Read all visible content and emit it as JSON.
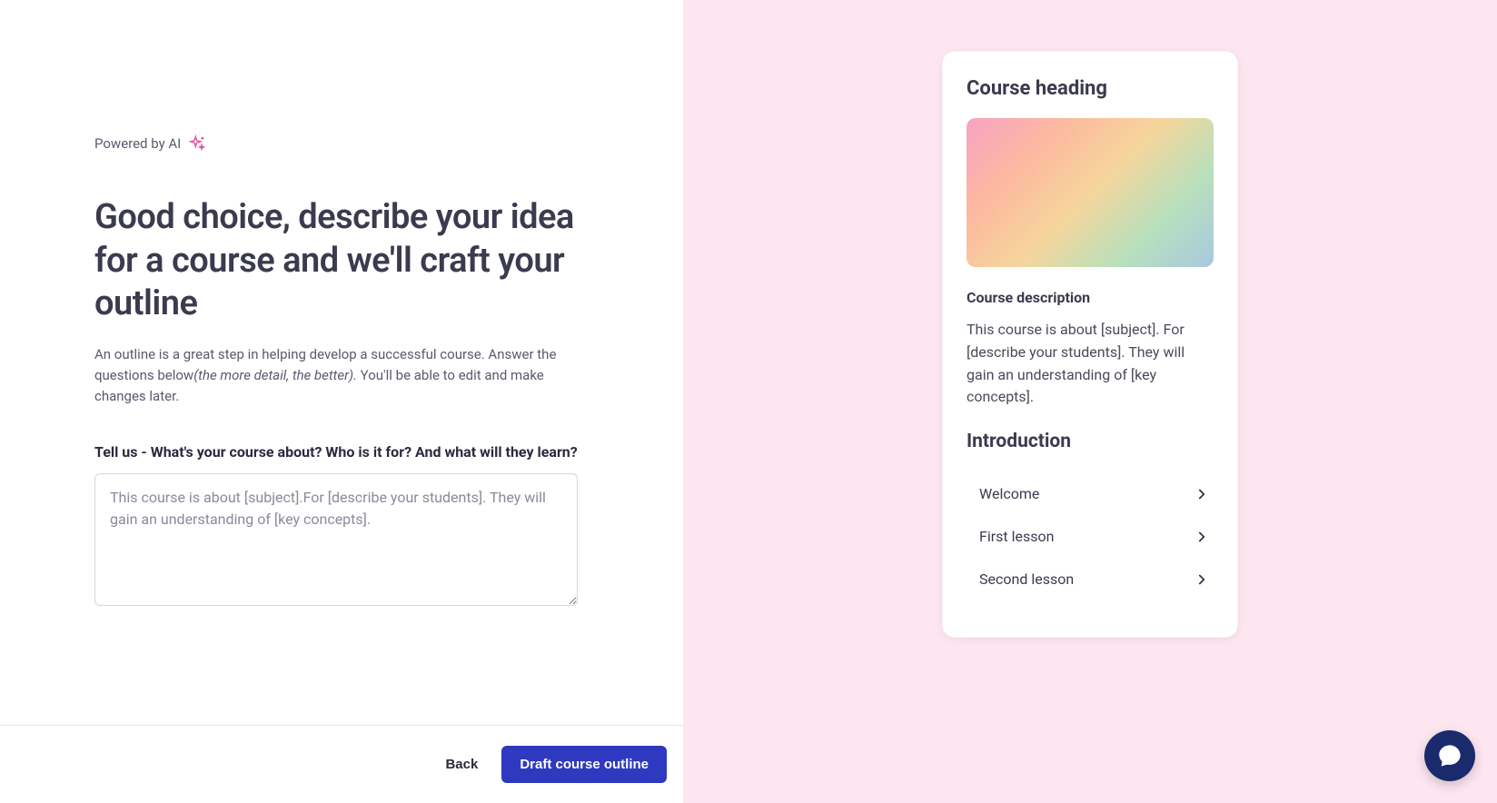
{
  "left": {
    "powered_by_label": "Powered by AI",
    "heading": "Good choice, describe your idea for a course and we'll craft  your outline",
    "subtext_prefix": "An outline is a great step in helping develop a successful course.  Answer the questions below",
    "subtext_italic": "(the more detail, the better).",
    "subtext_suffix": " You'll be able to edit and make changes later.",
    "form_label": "Tell us - What's your course about? Who is it for? And what will they learn?",
    "textarea_placeholder": "This course is about [subject].For [describe your students]. They will gain an understanding of [key concepts].",
    "back_label": "Back",
    "primary_label": "Draft course outline"
  },
  "preview": {
    "heading": "Course heading",
    "desc_label": "Course description",
    "desc_text": "This course is about [subject]. For [describe your students]. They will gain an understanding of [key concepts].",
    "section_title": "Introduction",
    "lessons": [
      {
        "label": "Welcome"
      },
      {
        "label": "First lesson"
      },
      {
        "label": "Second lesson"
      }
    ]
  }
}
